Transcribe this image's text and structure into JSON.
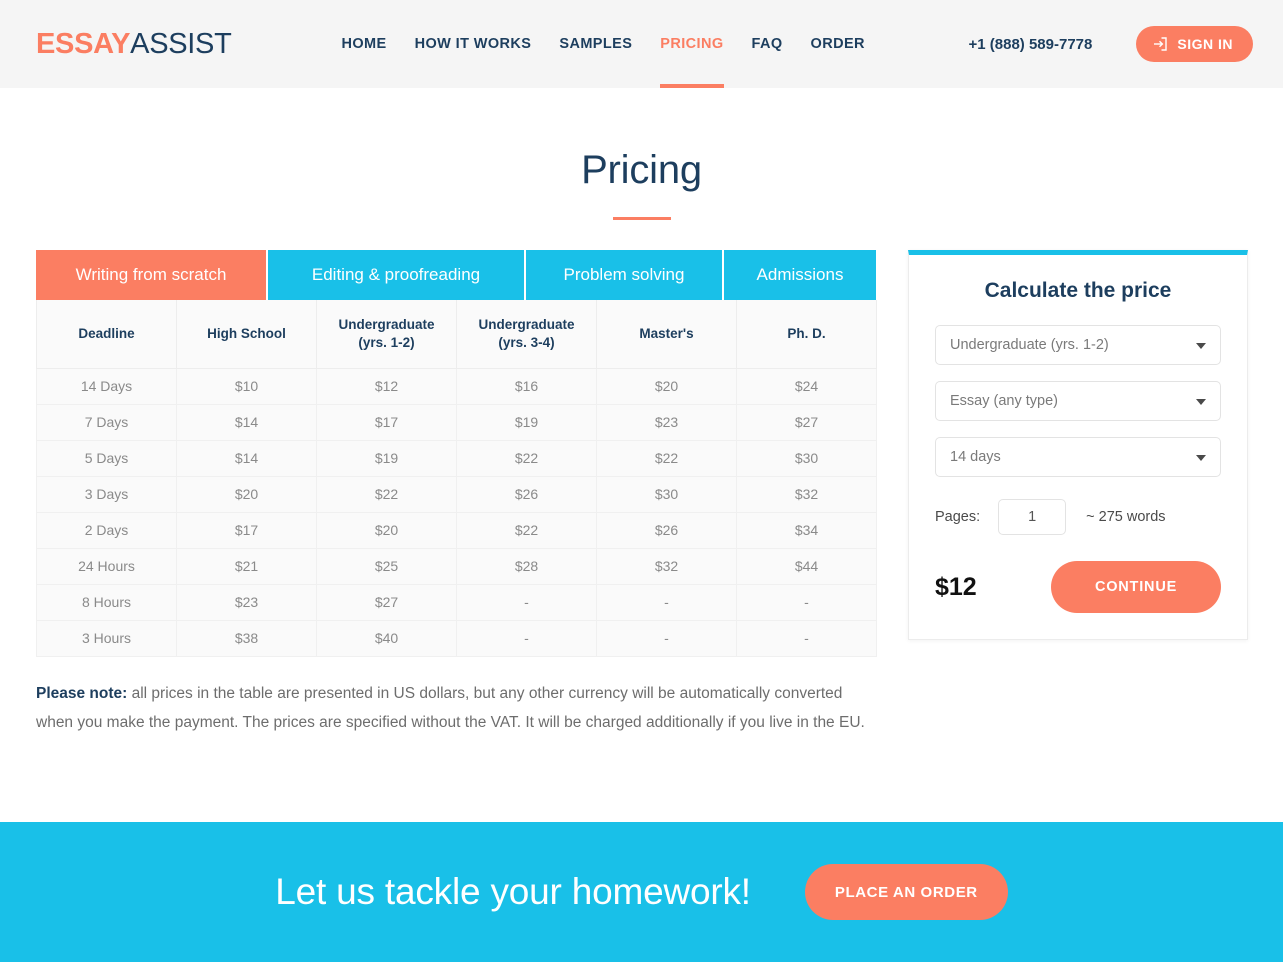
{
  "header": {
    "logo": {
      "part1": "ESSAY",
      "part2": "ASSIST"
    },
    "nav": [
      {
        "label": "HOME",
        "active": false
      },
      {
        "label": "HOW IT WORKS",
        "active": false
      },
      {
        "label": "SAMPLES",
        "active": false
      },
      {
        "label": "PRICING",
        "active": true
      },
      {
        "label": "FAQ",
        "active": false
      },
      {
        "label": "ORDER",
        "active": false
      }
    ],
    "phone": "+1 (888) 589-7778",
    "signin_label": "SIGN IN",
    "signin_icon": "login-icon",
    "bg_color": "#f5f5f5"
  },
  "page": {
    "title": "Pricing",
    "accent_color": "#fb7e62",
    "cyan_color": "#19c0e8",
    "navy_color": "#1d3e5e"
  },
  "tabs": [
    {
      "label": "Writing from scratch",
      "active": true
    },
    {
      "label": "Editing & proofreading",
      "active": false
    },
    {
      "label": "Problem solving",
      "active": false
    },
    {
      "label": "Admissions",
      "active": false
    }
  ],
  "table": {
    "headers": [
      "Deadline",
      "High School",
      "Undergraduate (yrs. 1-2)",
      "Undergraduate (yrs. 3-4)",
      "Master's",
      "Ph. D."
    ],
    "header_lines": [
      [
        "Deadline"
      ],
      [
        "High School"
      ],
      [
        "Undergraduate",
        "(yrs. 1-2)"
      ],
      [
        "Undergraduate",
        "(yrs. 3-4)"
      ],
      [
        "Master's"
      ],
      [
        "Ph. D."
      ]
    ],
    "rows": [
      {
        "deadline": "14 Days",
        "high_school": "$10",
        "ug12": "$12",
        "ug34": "$16",
        "masters": "$20",
        "phd": "$24"
      },
      {
        "deadline": "7 Days",
        "high_school": "$14",
        "ug12": "$17",
        "ug34": "$19",
        "masters": "$23",
        "phd": "$27"
      },
      {
        "deadline": "5 Days",
        "high_school": "$14",
        "ug12": "$19",
        "ug34": "$22",
        "masters": "$22",
        "phd": "$30"
      },
      {
        "deadline": "3 Days",
        "high_school": "$20",
        "ug12": "$22",
        "ug34": "$26",
        "masters": "$30",
        "phd": "$32"
      },
      {
        "deadline": "2 Days",
        "high_school": "$17",
        "ug12": "$20",
        "ug34": "$22",
        "masters": "$26",
        "phd": "$34"
      },
      {
        "deadline": "24 Hours",
        "high_school": "$21",
        "ug12": "$25",
        "ug34": "$28",
        "masters": "$32",
        "phd": "$44"
      },
      {
        "deadline": "8 Hours",
        "high_school": "$23",
        "ug12": "$27",
        "ug34": "-",
        "masters": "-",
        "phd": "-"
      },
      {
        "deadline": "3 Hours",
        "high_school": "$38",
        "ug12": "$40",
        "ug34": "-",
        "masters": "-",
        "phd": "-"
      }
    ]
  },
  "note": {
    "label": "Please note:",
    "text": " all prices in the table are presented in US dollars, but any other currency will be automatically converted when you make the payment. The prices are specified without the VAT. It will be charged additionally if you live in the EU."
  },
  "calculator": {
    "title": "Calculate the price",
    "academic_level": "Undergraduate (yrs. 1-2)",
    "paper_type": "Essay (any type)",
    "deadline": "14 days",
    "pages_label": "Pages:",
    "pages_value": "1",
    "words_hint": "~ 275 words",
    "total_price": "$12",
    "continue_label": "CONTINUE"
  },
  "cta": {
    "text": "Let us tackle your homework!",
    "button_label": "PLACE AN ORDER"
  }
}
